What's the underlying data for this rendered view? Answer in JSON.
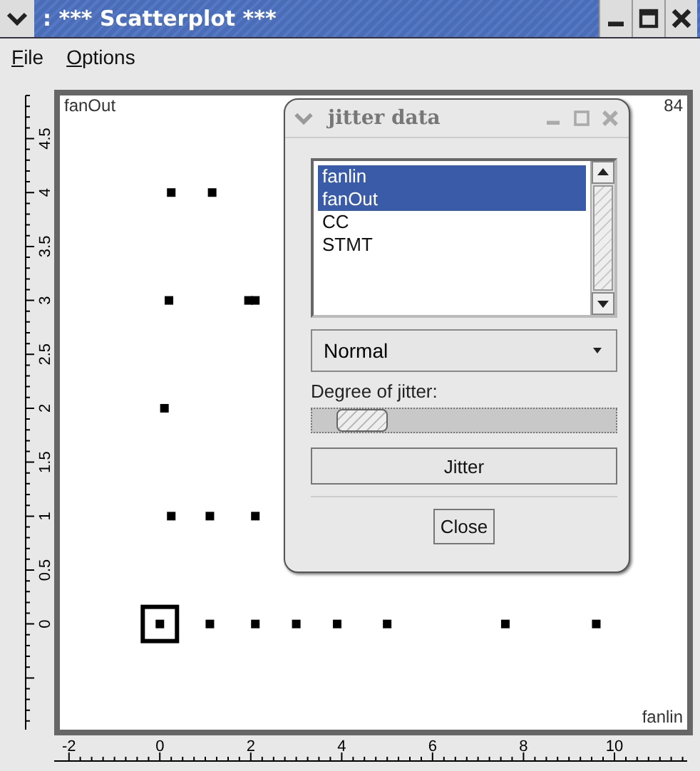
{
  "window": {
    "title": ": *** Scatterplot ***",
    "menu": [
      "File",
      "Options"
    ]
  },
  "plot": {
    "corner_value": "84",
    "selection_box": true,
    "chart_data": {
      "type": "scatter",
      "xlabel": "fanlin",
      "ylabel": "fanOut",
      "x": [
        0,
        1.1,
        2.1,
        3.0,
        3.9,
        5.0,
        7.6,
        9.6,
        0.25,
        1.1,
        2.1,
        0.1,
        0.2,
        1.95,
        2.1,
        0.25,
        1.15
      ],
      "series": [
        {
          "color": "#000000",
          "values": [
            0,
            0,
            0,
            0,
            0,
            0,
            0,
            0,
            1,
            1,
            1,
            2,
            3,
            3,
            3,
            4,
            4
          ]
        }
      ],
      "xlim": [
        -2.2,
        11.6
      ],
      "ylim": [
        -0.98,
        4.9
      ],
      "xticks": [
        -2,
        0,
        2,
        4,
        6,
        8,
        10
      ],
      "yticks": [
        0,
        {
          "value": 0.5,
          "label": "0.5"
        },
        1,
        {
          "value": 1.5,
          "label": "1.5"
        },
        2,
        {
          "value": 2.5,
          "label": "2.5"
        },
        3,
        {
          "value": 3.5,
          "label": "3.5"
        },
        4,
        {
          "value": 4.5,
          "label": "4.5"
        }
      ]
    }
  },
  "dialog": {
    "title": "jitter data",
    "list": [
      {
        "label": "fanlin",
        "selected": true
      },
      {
        "label": "fanOut",
        "selected": true
      },
      {
        "label": "CC",
        "selected": false
      },
      {
        "label": "STMT",
        "selected": false
      }
    ],
    "distribution": "Normal",
    "slider": {
      "label": "Degree of jitter:",
      "level": 0.08
    },
    "buttons": [
      "Jitter",
      "Close"
    ]
  }
}
